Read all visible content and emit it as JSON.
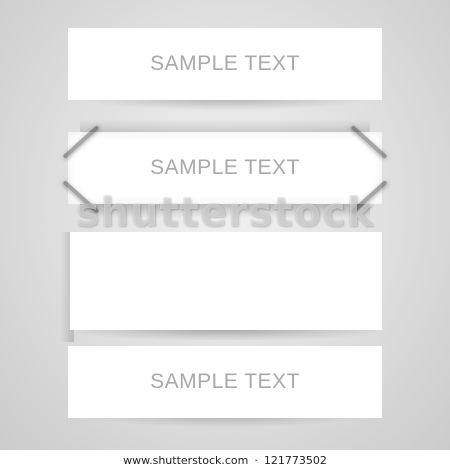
{
  "banners": [
    {
      "text": "SAMPLE TEXT"
    },
    {
      "text": "SAMPLE TEXT"
    },
    {
      "text": ""
    },
    {
      "text": "SAMPLE TEXT"
    }
  ],
  "watermark": {
    "text": "shutterstock"
  },
  "footer": {
    "site": "www.shutterstock.com",
    "separator": "·",
    "image_id": "121773502"
  },
  "colors": {
    "background": "#d9d9d9",
    "banner": "#ffffff",
    "banner_text": "#a9a9a9"
  }
}
